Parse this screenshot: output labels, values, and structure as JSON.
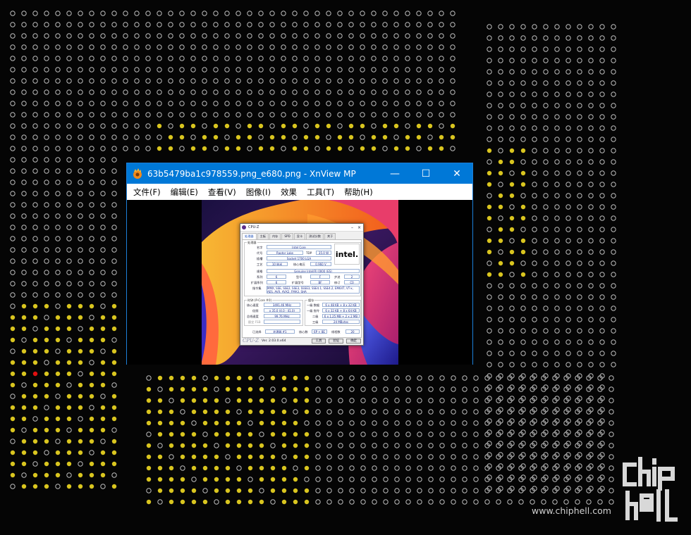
{
  "window": {
    "title": "63b5479ba1c978559.png_e680.png - XnView MP",
    "controls": {
      "minimize": "—",
      "maximize": "☐",
      "close": "✕"
    },
    "accent": "#0078d7"
  },
  "menu": [
    {
      "label": "文件(F)"
    },
    {
      "label": "编辑(E)"
    },
    {
      "label": "查看(V)"
    },
    {
      "label": "图像(I)"
    },
    {
      "label": "效果"
    },
    {
      "label": "工具(T)"
    },
    {
      "label": "帮助(H)"
    }
  ],
  "cpuz": {
    "title": "CPU-Z",
    "tabs": [
      "处理器",
      "主板",
      "内存",
      "SPD",
      "显卡",
      "测试分数",
      "关于"
    ],
    "processor_group": "处理器",
    "name_label": "名字",
    "name": "Intel Core",
    "codename_label": "代号",
    "codename": "Raptor Lake",
    "tdp_label": "TDP",
    "tdp": "35.0 W",
    "package_label": "插槽",
    "package": "Socket 1700 LGA",
    "tech_label": "工艺",
    "tech": "10 纳米",
    "voltage_label": "核心电压",
    "voltage": "0.960 V",
    "spec_label": "规格",
    "spec": "Genuine Intel(R) 0000 (ES)",
    "family_label": "系列",
    "family": "6",
    "model_label": "型号",
    "model": "F",
    "stepping_label": "步进",
    "stepping": "2",
    "extfamily_label": "扩展系列",
    "extfamily": "6",
    "extmodel_label": "扩展型号",
    "extmodel": "BF",
    "revision_label": "修订",
    "revision": "C0",
    "instr_label": "指令集",
    "instructions": "MMX, SSE, SSE2, SSE3, SSSE3, SSE4.1, SSE4.2, EM64T, VT-x, AES, AVX, AVX2, FMA3, SHA",
    "clocks_group": "时钟 (P-Core #0)",
    "corespeed_label": "核心速度",
    "corespeed": "3491.46 MHz",
    "multi_label": "倍频",
    "multi": "x 35.0 (4.0 - 41.0)",
    "bus_label": "总线速度",
    "bus": "99.76 MHz",
    "fsb_label": "额定 FSB",
    "cache_group": "缓存",
    "l1d_label": "一级 数据",
    "l1d": "6 x 48 KB + 8 x 32 KB",
    "l1i_label": "一级 指令",
    "l1i": "6 x 32 KB + 8 x 64 KB",
    "l2_label": "二级",
    "l2": "6 x 1.25 MB + 2 x 2 MB",
    "l3_label": "三级",
    "l3": "24 MBytes",
    "selection_label": "已选择",
    "selection": "处理器 #1",
    "cores_label": "核心数",
    "cores": "6P + 8E",
    "threads_label": "线程数",
    "threads": "20",
    "brand": "CPU-Z",
    "version": "Ver. 2.03.0.x64",
    "tools_label": "工具",
    "validate_label": "验证",
    "ok_label": "确定",
    "logo_text": "intel."
  },
  "watermark": {
    "url": "www.chiphell.com",
    "logo_text": "chiphell"
  }
}
